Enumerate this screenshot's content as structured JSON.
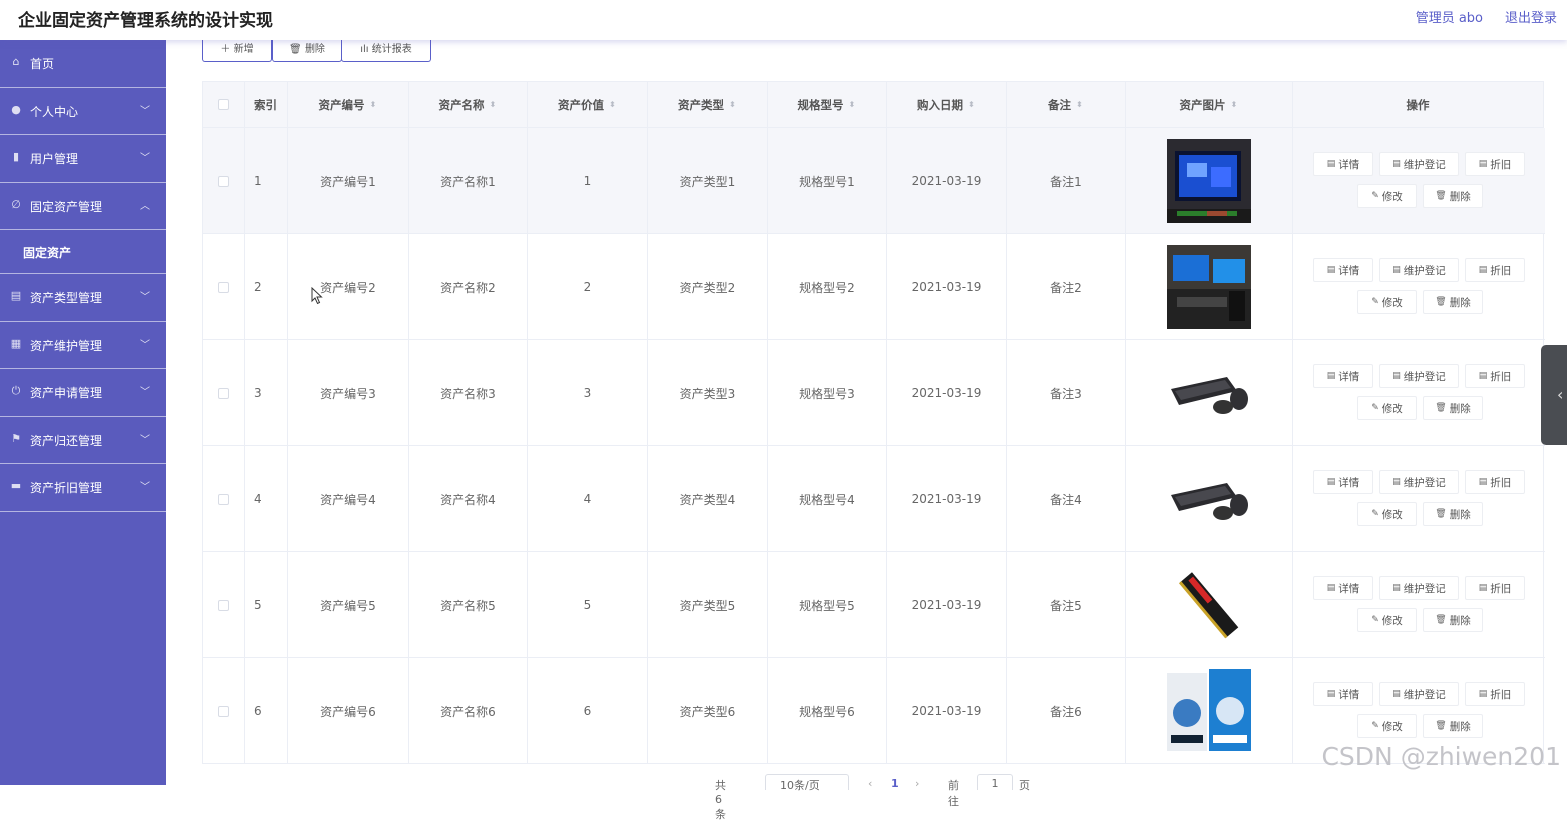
{
  "header": {
    "title": "企业固定资产管理系统的设计实现",
    "admin": "管理员 abo",
    "logout": "退出登录"
  },
  "sidebar": {
    "items": [
      {
        "label": "首页",
        "icon": "home-icon",
        "arrow": ""
      },
      {
        "label": "个人中心",
        "icon": "user-icon",
        "arrow": "chevron-down"
      },
      {
        "label": "用户管理",
        "icon": "bar-chart-icon",
        "arrow": "chevron-down"
      },
      {
        "label": "固定资产管理",
        "icon": "bell-off-icon",
        "arrow": "chevron-up"
      },
      {
        "label": "固定资产",
        "icon": "",
        "arrow": "",
        "submenu": true
      },
      {
        "label": "资产类型管理",
        "icon": "clipboard-icon",
        "arrow": "chevron-down"
      },
      {
        "label": "资产维护管理",
        "icon": "grid-icon",
        "arrow": "chevron-down"
      },
      {
        "label": "资产申请管理",
        "icon": "power-icon",
        "arrow": "chevron-down"
      },
      {
        "label": "资产归还管理",
        "icon": "flag-icon",
        "arrow": "chevron-down"
      },
      {
        "label": "资产折旧管理",
        "icon": "briefcase-icon",
        "arrow": "chevron-down"
      }
    ]
  },
  "toolbar": {
    "add": "新增",
    "delete": "删除",
    "report": "统计报表"
  },
  "table": {
    "headers": {
      "index": "索引",
      "code": "资产编号",
      "name": "资产名称",
      "value": "资产价值",
      "type": "资产类型",
      "model": "规格型号",
      "date": "购入日期",
      "note": "备注",
      "image": "资产图片",
      "ops": "操作"
    },
    "rows": [
      {
        "index": "1",
        "code": "资产编号1",
        "name": "资产名称1",
        "value": "1",
        "type": "资产类型1",
        "model": "规格型号1",
        "date": "2021-03-19",
        "note": "备注1",
        "image": "monitor-photo"
      },
      {
        "index": "2",
        "code": "资产编号2",
        "name": "资产名称2",
        "value": "2",
        "type": "资产类型2",
        "model": "规格型号2",
        "date": "2021-03-19",
        "note": "备注2",
        "image": "workstation-photo"
      },
      {
        "index": "3",
        "code": "资产编号3",
        "name": "资产名称3",
        "value": "3",
        "type": "资产类型3",
        "model": "规格型号3",
        "date": "2021-03-19",
        "note": "备注3",
        "image": "keyboard-mouse-photo"
      },
      {
        "index": "4",
        "code": "资产编号4",
        "name": "资产名称4",
        "value": "4",
        "type": "资产类型4",
        "model": "规格型号4",
        "date": "2021-03-19",
        "note": "备注4",
        "image": "keyboard-mouse-photo"
      },
      {
        "index": "5",
        "code": "资产编号5",
        "name": "资产名称5",
        "value": "5",
        "type": "资产类型5",
        "model": "规格型号5",
        "date": "2021-03-19",
        "note": "备注5",
        "image": "memory-stick-photo"
      },
      {
        "index": "6",
        "code": "资产编号6",
        "name": "资产名称6",
        "value": "6",
        "type": "资产类型6",
        "model": "规格型号6",
        "date": "2021-03-19",
        "note": "备注6",
        "image": "product-box-photo"
      }
    ],
    "actions": {
      "detail": "详情",
      "maintain": "维护登记",
      "depreciate": "折旧",
      "edit": "修改",
      "delete": "删除"
    }
  },
  "pagination": {
    "total": "共 6 条",
    "size": "10条/页",
    "current": "1",
    "goto": "前往",
    "goto_value": "1",
    "page_suffix": "页"
  },
  "watermark": "CSDN @zhiwen201",
  "colors": {
    "sidebar": "#5a5bbd",
    "accent": "#5a5fc9",
    "header_bg": "#f5f6fa"
  }
}
